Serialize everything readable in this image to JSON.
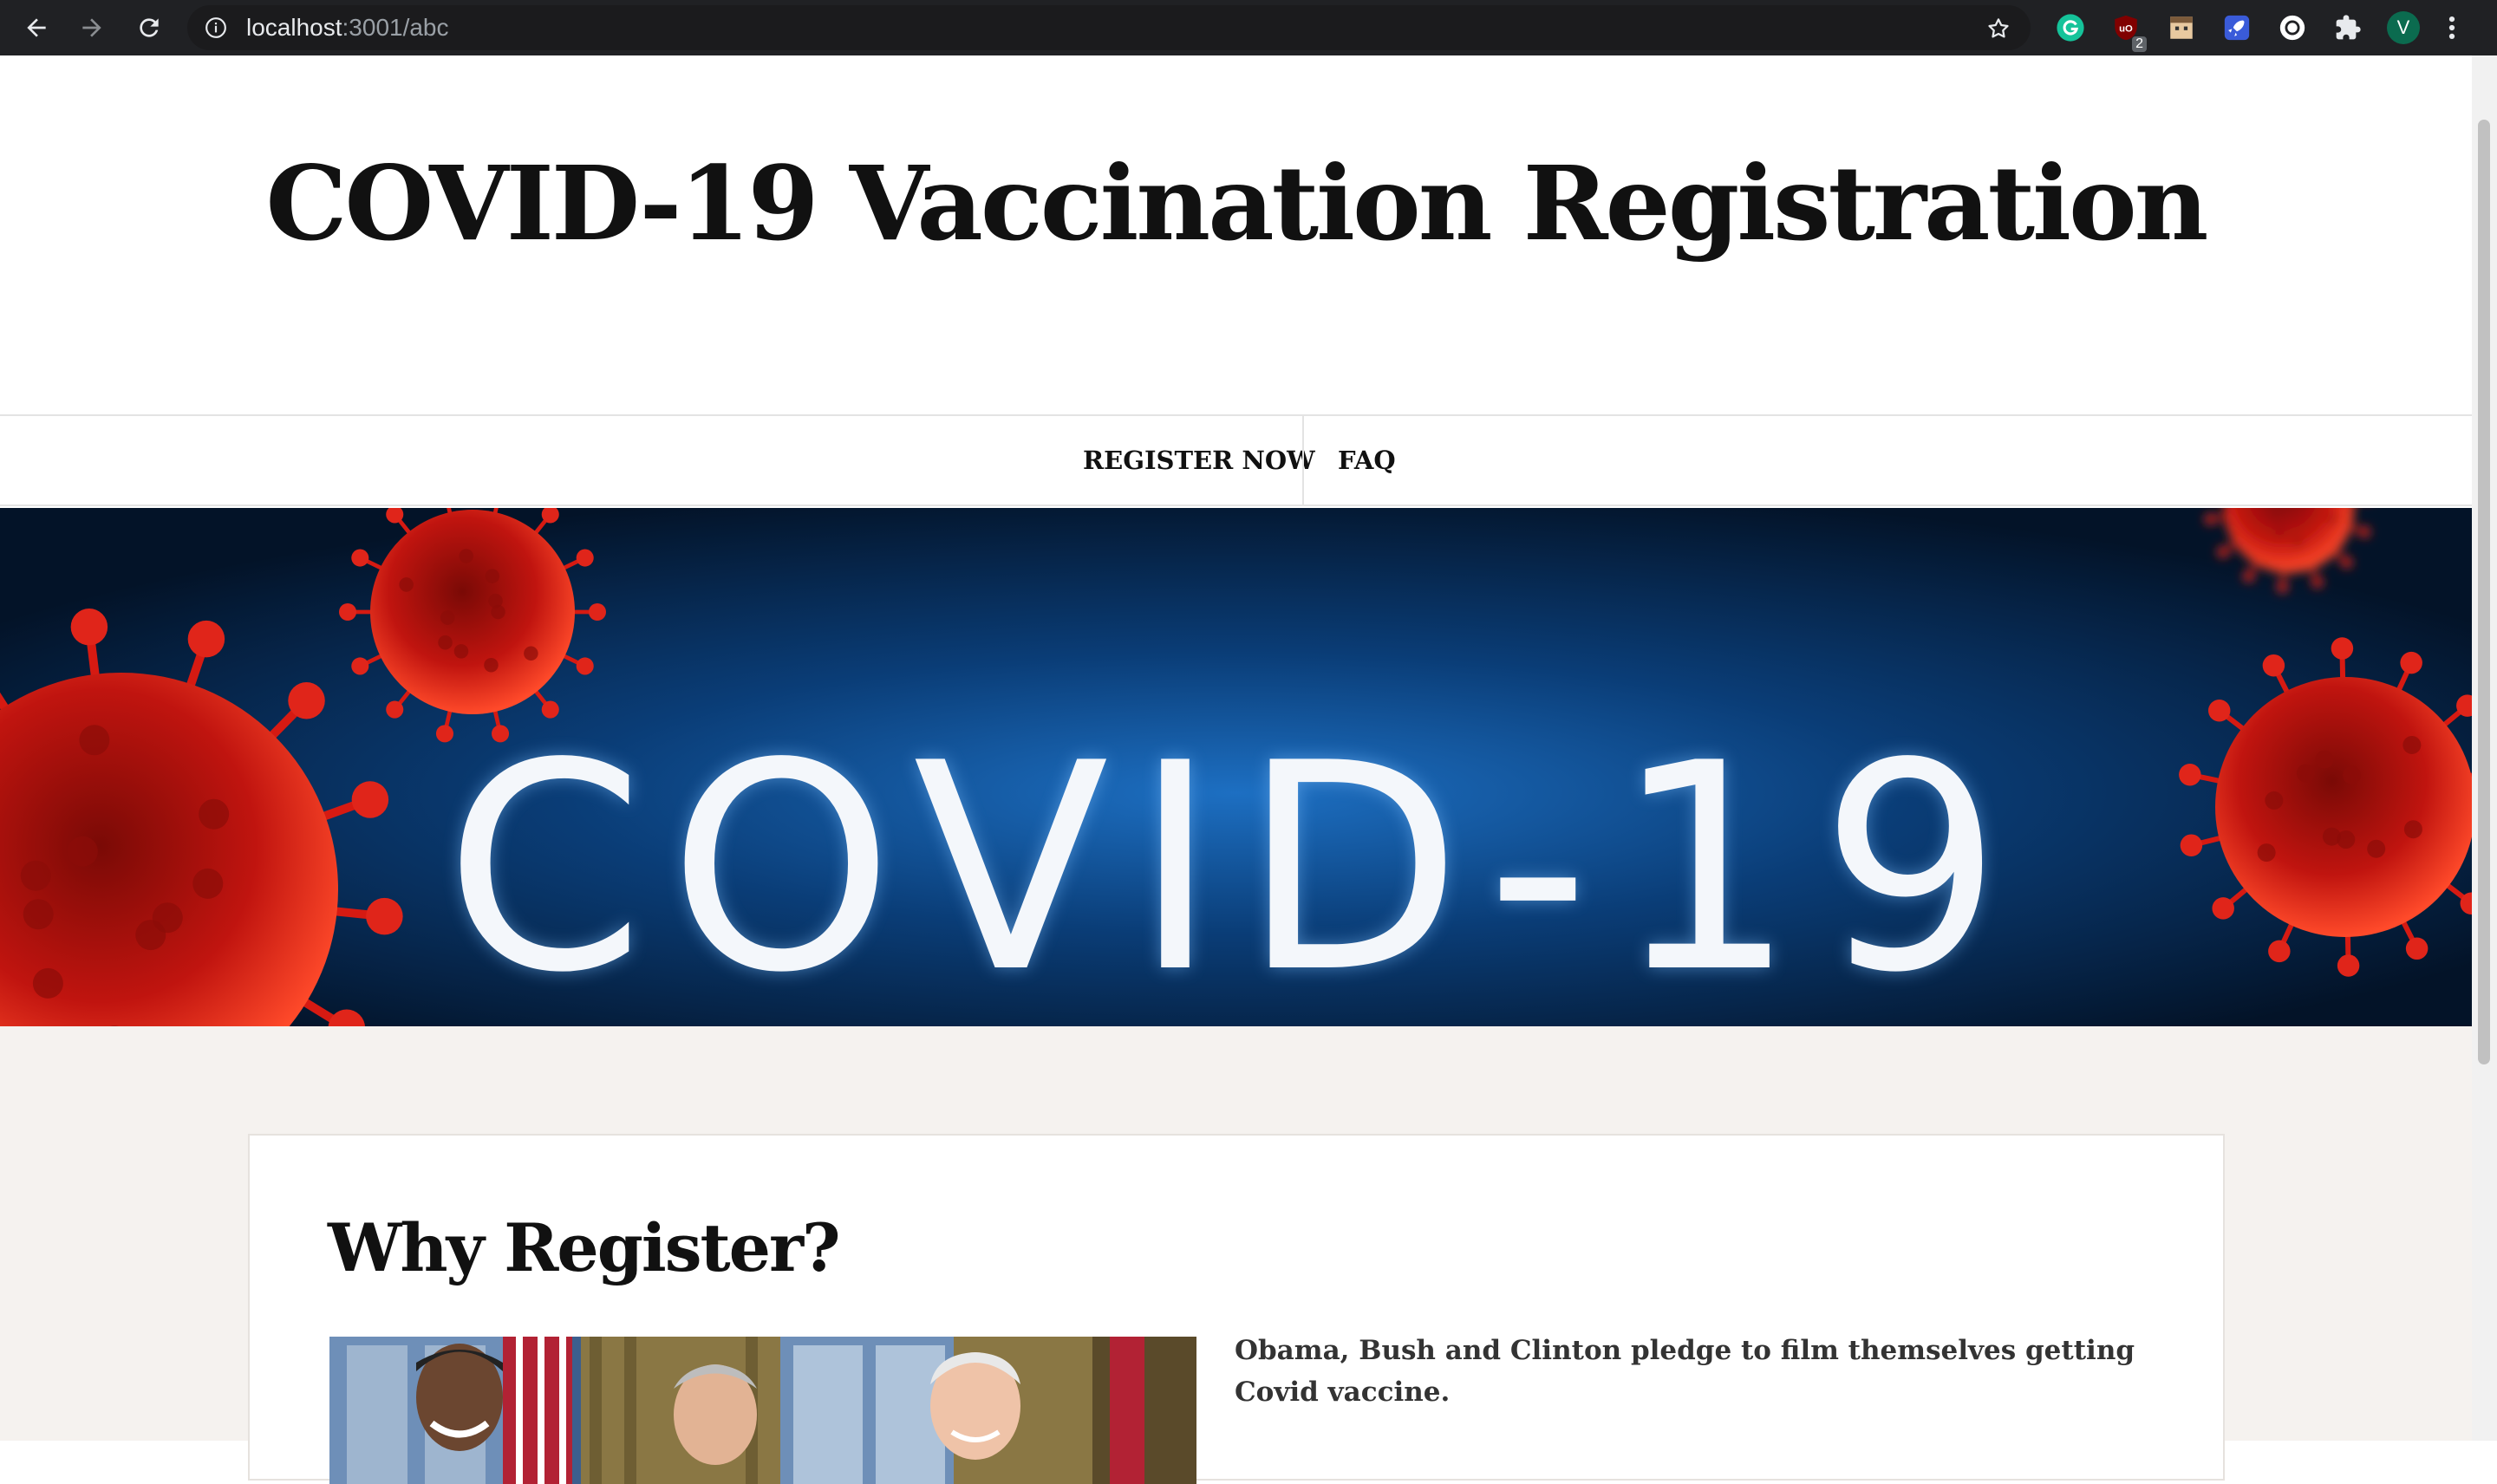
{
  "browser": {
    "url_host": "localhost",
    "url_path": ":3001/abc",
    "extensions": [
      {
        "name": "grammarly-extension",
        "color": "#15c39a",
        "badge": ""
      },
      {
        "name": "ublock-extension",
        "color": "#800000",
        "badge": "2"
      },
      {
        "name": "character-extension",
        "color": "#e8c9a0",
        "badge": ""
      },
      {
        "name": "rocket-extension",
        "color": "#4f8cff",
        "badge": ""
      },
      {
        "name": "circle-extension",
        "color": "#ffffff",
        "badge": ""
      },
      {
        "name": "puzzle-extension",
        "color": "#e8eaed",
        "badge": ""
      }
    ],
    "profile_initial": "V",
    "profile_color": "#0b6b4f"
  },
  "site": {
    "title": "COVID-19 Vaccination Registration"
  },
  "menu": {
    "register_label": "REGISTER NOW",
    "faq_label": "FAQ"
  },
  "hero": {
    "text": "COVID-19",
    "bg_color": "#0a2c55",
    "virus_color": "#c0140f"
  },
  "section": {
    "heading": "Why Register?",
    "caption": "Obama, Bush and Clinton pledge to film themselves getting Covid vaccine."
  }
}
